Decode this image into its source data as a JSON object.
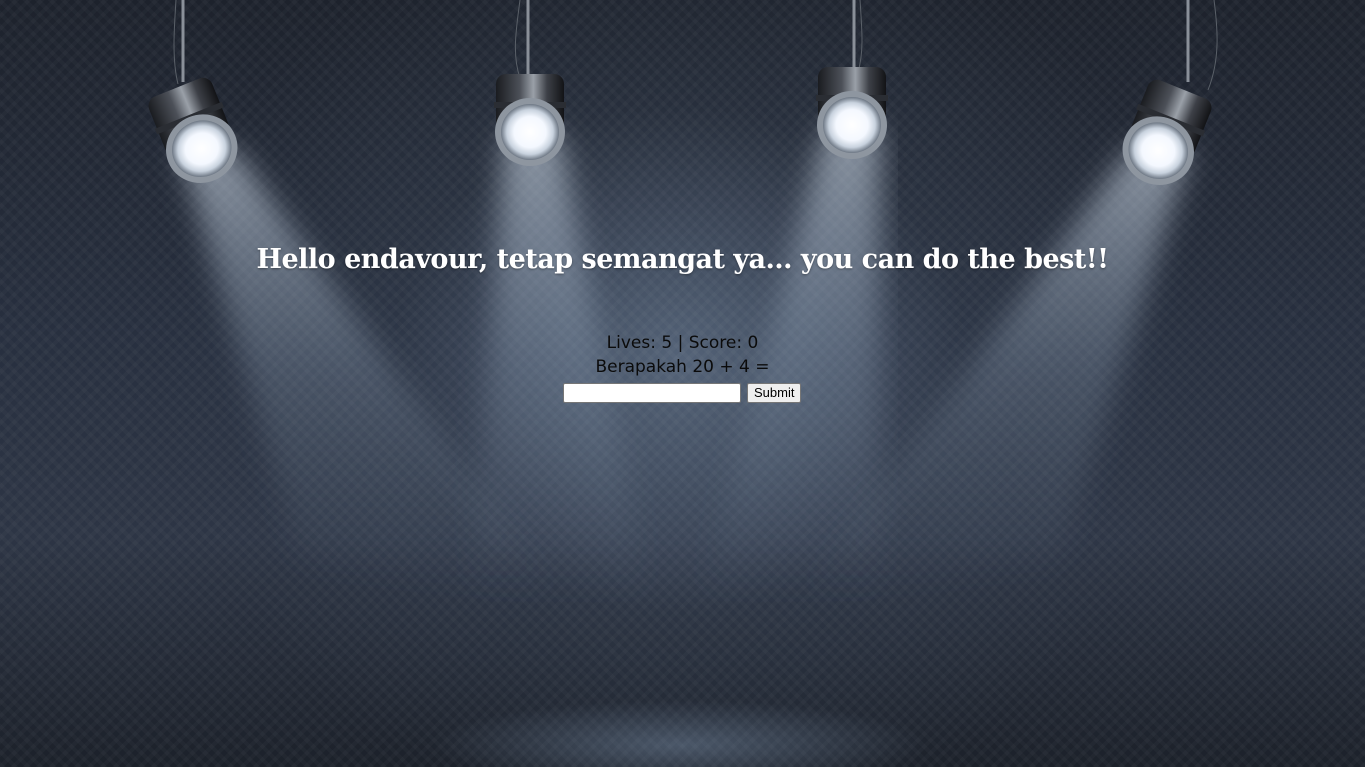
{
  "title": "Hello endavour, tetap semangat ya… you can do the best!!",
  "status": {
    "lives_label": "Lives:",
    "lives": "5",
    "separator": "|",
    "score_label": "Score:",
    "score": "0"
  },
  "question": {
    "text": "Berapakah 20 + 4 ="
  },
  "answer": {
    "value": "",
    "placeholder": ""
  },
  "submit_label": "Submit",
  "icons": {
    "spotlight": "spotlight-icon"
  },
  "colors": {
    "background": "#252c38",
    "title": "#ffffff",
    "text": "#0b0b0b"
  }
}
